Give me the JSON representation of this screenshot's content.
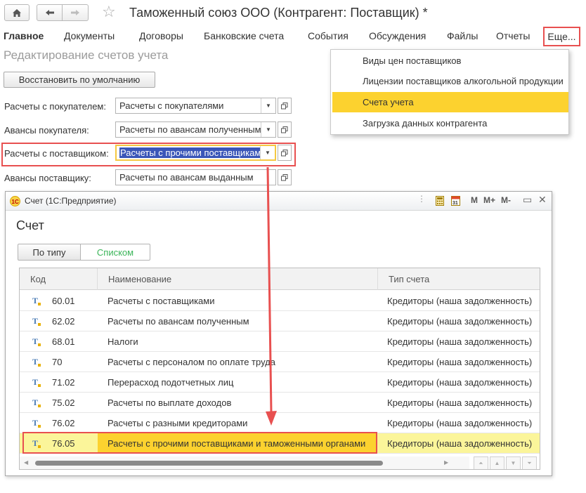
{
  "header": {
    "title": "Таможенный союз ООО (Контрагент: Поставщик) *"
  },
  "menu": {
    "items": [
      "Главное",
      "Документы",
      "Договоры",
      "Банковские счета",
      "События",
      "Обсуждения",
      "Файлы",
      "Отчеты"
    ],
    "more_label": "Еще..."
  },
  "section": {
    "title": "Редактирование счетов учета",
    "restore_label": "Восстановить по умолчанию"
  },
  "fields": [
    {
      "label": "Расчеты с покупателем:",
      "value": "Расчеты с покупателями"
    },
    {
      "label": "Авансы покупателя:",
      "value": "Расчеты по авансам полученным"
    },
    {
      "label": "Расчеты с поставщиком:",
      "value": "Расчеты с прочими поставщиками"
    },
    {
      "label": "Авансы поставщику:",
      "value": "Расчеты по авансам выданным"
    }
  ],
  "popup": {
    "items": [
      "Виды цен поставщиков",
      "Лицензии поставщиков алкогольной продукции",
      "Счета учета",
      "Загрузка данных контрагента"
    ],
    "selected": "Счета учета"
  },
  "window": {
    "title": "Счет  (1С:Предприятие)",
    "heading": "Счет",
    "toolbar": {
      "m": "M",
      "mplus": "M+",
      "mminus": "M-"
    },
    "tabs": [
      {
        "label": "По типу",
        "active": false
      },
      {
        "label": "Списком",
        "active": true
      }
    ],
    "columns": [
      "Код",
      "Наименование",
      "Тип счета"
    ],
    "rows": [
      {
        "code": "60.01",
        "name": "Расчеты с поставщиками",
        "type": "Кредиторы (наша задолженность)"
      },
      {
        "code": "62.02",
        "name": "Расчеты по авансам полученным",
        "type": "Кредиторы (наша задолженность)"
      },
      {
        "code": "68.01",
        "name": "Налоги",
        "type": "Кредиторы (наша задолженность)"
      },
      {
        "code": "70",
        "name": "Расчеты с персоналом по оплате труда",
        "type": "Кредиторы (наша задолженность)"
      },
      {
        "code": "71.02",
        "name": "Перерасход подотчетных лиц",
        "type": "Кредиторы (наша задолженность)"
      },
      {
        "code": "75.02",
        "name": "Расчеты по выплате доходов",
        "type": "Кредиторы (наша задолженность)"
      },
      {
        "code": "76.02",
        "name": "Расчеты с разными кредиторами",
        "type": "Кредиторы (наша задолженность)"
      },
      {
        "code": "76.05",
        "name": "Расчеты с прочими поставщиками и таможенными органами",
        "type": "Кредиторы (наша задолженность)"
      }
    ],
    "selected_code": "76.05"
  },
  "colors": {
    "highlight_red": "#e85050",
    "selection_yellow": "#fcd22f",
    "row_highlight": "#fbf59a",
    "selected_text_bg": "#3a56b8",
    "tab_active_text": "#3cb55a"
  },
  "icons": [
    "home-icon",
    "back-icon",
    "forward-icon",
    "star-icon",
    "onec-logo-icon",
    "calculator-icon",
    "calendar-icon",
    "account-type-icon"
  ]
}
